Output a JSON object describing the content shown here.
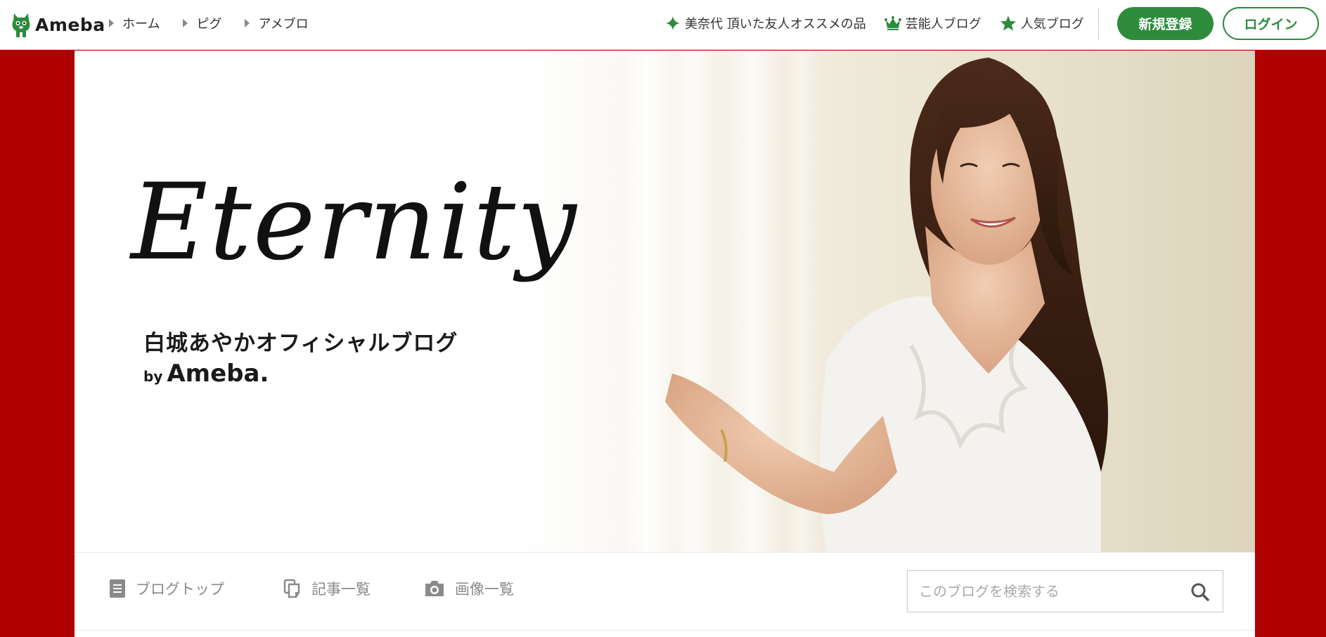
{
  "header": {
    "logo_text": "Ameba",
    "nav_left": [
      {
        "label": "ホーム"
      },
      {
        "label": "ピグ"
      },
      {
        "label": "アメブロ"
      }
    ],
    "nav_right": [
      {
        "label": "美奈代 頂いた友人オススメの品",
        "icon": "sparkle-icon"
      },
      {
        "label": "芸能人ブログ",
        "icon": "crown-icon"
      },
      {
        "label": "人気ブログ",
        "icon": "star-icon"
      }
    ],
    "register_label": "新規登録",
    "login_label": "ログイン"
  },
  "banner": {
    "title": "Eternity",
    "subtitle": "白城あやかオフィシャルブログ",
    "by": "by",
    "brand": "Ameba."
  },
  "blog_nav": {
    "items": [
      {
        "label": "ブログトップ",
        "icon": "document-icon"
      },
      {
        "label": "記事一覧",
        "icon": "copy-icon"
      },
      {
        "label": "画像一覧",
        "icon": "camera-icon"
      }
    ],
    "search_placeholder": "このブログを検索する"
  },
  "colors": {
    "brand_green": "#2d8c3c",
    "page_background": "#b10000",
    "icon_gray": "#8a8a8a"
  }
}
